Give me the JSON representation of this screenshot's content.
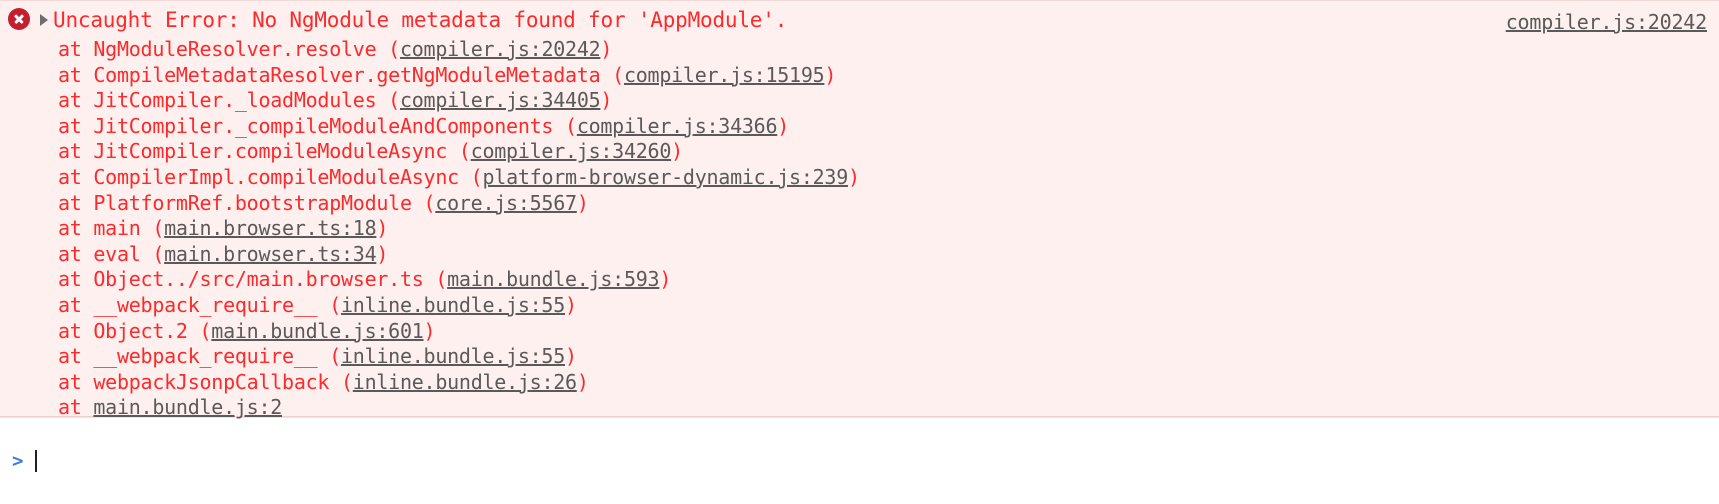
{
  "console": {
    "error_entry": {
      "icon": "error-circle-icon",
      "expander": "disclosure-triangle-icon",
      "message": "Uncaught Error: No NgModule metadata found for 'AppModule'.",
      "source_link": "compiler.js:20242"
    },
    "stack_frames": [
      {
        "text": "at NgModuleResolver.resolve (",
        "source": "compiler.js:20242",
        "suffix": ")"
      },
      {
        "text": "at CompileMetadataResolver.getNgModuleMetadata (",
        "source": "compiler.js:15195",
        "suffix": ")"
      },
      {
        "text": "at JitCompiler._loadModules (",
        "source": "compiler.js:34405",
        "suffix": ")"
      },
      {
        "text": "at JitCompiler._compileModuleAndComponents (",
        "source": "compiler.js:34366",
        "suffix": ")"
      },
      {
        "text": "at JitCompiler.compileModuleAsync (",
        "source": "compiler.js:34260",
        "suffix": ")"
      },
      {
        "text": "at CompilerImpl.compileModuleAsync (",
        "source": "platform-browser-dynamic.js:239",
        "suffix": ")"
      },
      {
        "text": "at PlatformRef.bootstrapModule (",
        "source": "core.js:5567",
        "suffix": ")"
      },
      {
        "text": "at main (",
        "source": "main.browser.ts:18",
        "suffix": ")"
      },
      {
        "text": "at eval (",
        "source": "main.browser.ts:34",
        "suffix": ")"
      },
      {
        "text": "at Object../src/main.browser.ts (",
        "source": "main.bundle.js:593",
        "suffix": ")"
      },
      {
        "text": "at __webpack_require__ (",
        "source": "inline.bundle.js:55",
        "suffix": ")"
      },
      {
        "text": "at Object.2 (",
        "source": "main.bundle.js:601",
        "suffix": ")"
      },
      {
        "text": "at __webpack_require__ (",
        "source": "inline.bundle.js:55",
        "suffix": ")"
      },
      {
        "text": "at webpackJsonpCallback (",
        "source": "inline.bundle.js:26",
        "suffix": ")"
      },
      {
        "text": "at ",
        "source": "main.bundle.js:2",
        "suffix": ""
      }
    ],
    "prompt": {
      "chevron": ">",
      "value": "",
      "placeholder": ""
    },
    "colors": {
      "error_text": "#fc2a2a",
      "error_background": "#fdf0ef",
      "source_link": "#5a5a5a",
      "icon_background": "#c31f2e",
      "prompt_chevron": "#3e7bd9"
    }
  }
}
